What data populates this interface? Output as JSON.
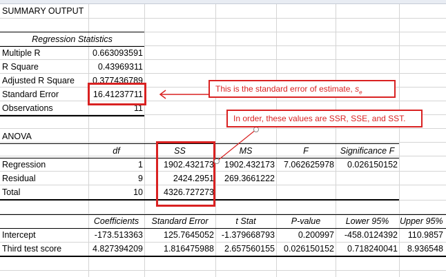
{
  "summary_title": "SUMMARY OUTPUT",
  "regression_statistics": {
    "heading": "Regression Statistics",
    "rows": [
      {
        "label": "Multiple R",
        "value": "0.663093591"
      },
      {
        "label": "R Square",
        "value": "0.43969311"
      },
      {
        "label": "Adjusted R Square",
        "value": "0.377436789"
      },
      {
        "label": "Standard Error",
        "value": "16.41237711"
      },
      {
        "label": "Observations",
        "value": "11"
      }
    ]
  },
  "anova": {
    "title": "ANOVA",
    "headers": {
      "df": "df",
      "ss": "SS",
      "ms": "MS",
      "f": "F",
      "sigf": "Significance F"
    },
    "rows": [
      {
        "label": "Regression",
        "df": "1",
        "ss": "1902.432173",
        "ms": "1902.432173",
        "f": "7.062625978",
        "sigf": "0.026150152"
      },
      {
        "label": "Residual",
        "df": "9",
        "ss": "2424.2951",
        "ms": "269.3661222",
        "f": "",
        "sigf": ""
      },
      {
        "label": "Total",
        "df": "10",
        "ss": "4326.727273",
        "ms": "",
        "f": "",
        "sigf": ""
      }
    ]
  },
  "coefficients": {
    "headers": {
      "coef": "Coefficients",
      "se": "Standard Error",
      "t": "t Stat",
      "p": "P-value",
      "lower": "Lower 95%",
      "upper": "Upper 95%"
    },
    "rows": [
      {
        "label": "Intercept",
        "coef": "-173.513363",
        "se": "125.7645052",
        "t": "-1.379668793",
        "p": "0.200997",
        "lower": "-458.0124392",
        "upper": "110.9857"
      },
      {
        "label": "Third test score",
        "coef": "4.827394209",
        "se": "1.816475988",
        "t": "2.657560155",
        "p": "0.026150152",
        "lower": "0.718240041",
        "upper": "8.936548"
      }
    ]
  },
  "annotations": {
    "std_error_note": "This is the standard error of estimate, ",
    "std_error_symbol": "s",
    "std_error_subscript": "e",
    "ss_note": "In order, these values are SSR, SSE, and SST."
  },
  "colors": {
    "annotation_red": "#d92121",
    "gridline": "#d4d4d4"
  }
}
